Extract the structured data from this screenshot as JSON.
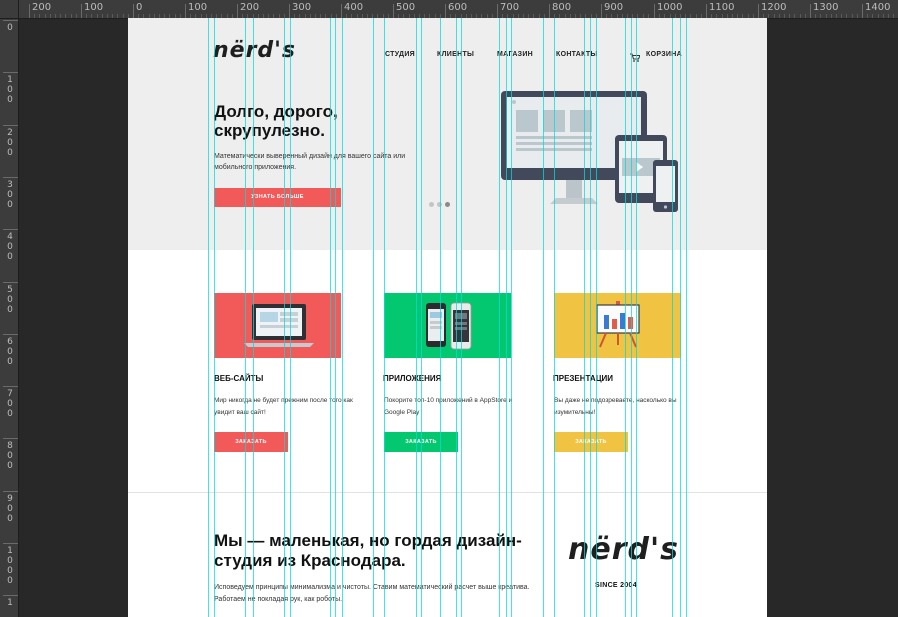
{
  "ruler": {
    "top_labels": [
      "200",
      "100",
      "0",
      "100",
      "200",
      "300",
      "400",
      "500",
      "600",
      "700",
      "800",
      "900",
      "1000",
      "1100",
      "1200",
      "1300",
      "1400"
    ],
    "left_labels": [
      "0",
      "100",
      "200",
      "300",
      "400",
      "500",
      "600",
      "700",
      "800",
      "900",
      "1000",
      "1"
    ]
  },
  "site": {
    "logo": "nërd's",
    "nav": [
      "СТУДИЯ",
      "КЛИЕНТЫ",
      "МАГАЗИН",
      "КОНТАКТЫ"
    ],
    "cart": "КОРЗИНА"
  },
  "hero": {
    "title": "Долго, дорого, скрупулезно.",
    "subtitle": "Математически выверенный дизайн для вашего сайта или мобильного приложения.",
    "button": "УЗНАТЬ БОЛЬШЕ",
    "slides": 3,
    "active_slide": 3
  },
  "services": [
    {
      "title": "ВЕБ-САЙТЫ",
      "text": "Мир никогда не будет прежним после того как увидит ваш сайт!",
      "button": "ЗАКАЗАТЬ",
      "color": "#f25a5a"
    },
    {
      "title": "ПРИЛОЖЕНИЯ",
      "text": "Покорите топ-10 приложений в AppStore и Google Play",
      "button": "ЗАКАЗАТЬ",
      "color": "#04c86f"
    },
    {
      "title": "ПРЕЗЕНТАЦИИ",
      "text": "Вы даже не подозреваете, насколько вы изумительны!",
      "button": "ЗАКАЗАТЬ",
      "color": "#f0c442"
    }
  ],
  "about": {
    "title": "Мы — маленькая, но гордая дизайн-студия из Краснодара.",
    "text": "Исповедуем принципы минимализма и чистоты. Ставим математический расчет выше креатива. Работаем не покладая рук, как роботы.",
    "logo": "nërd's",
    "since": "SINCE 2004"
  },
  "colors": {
    "accent_red": "#f25a5a",
    "accent_green": "#04c86f",
    "accent_yellow": "#f0c442",
    "guide": "#00dcdc",
    "hero_bg": "#eeeeee"
  }
}
